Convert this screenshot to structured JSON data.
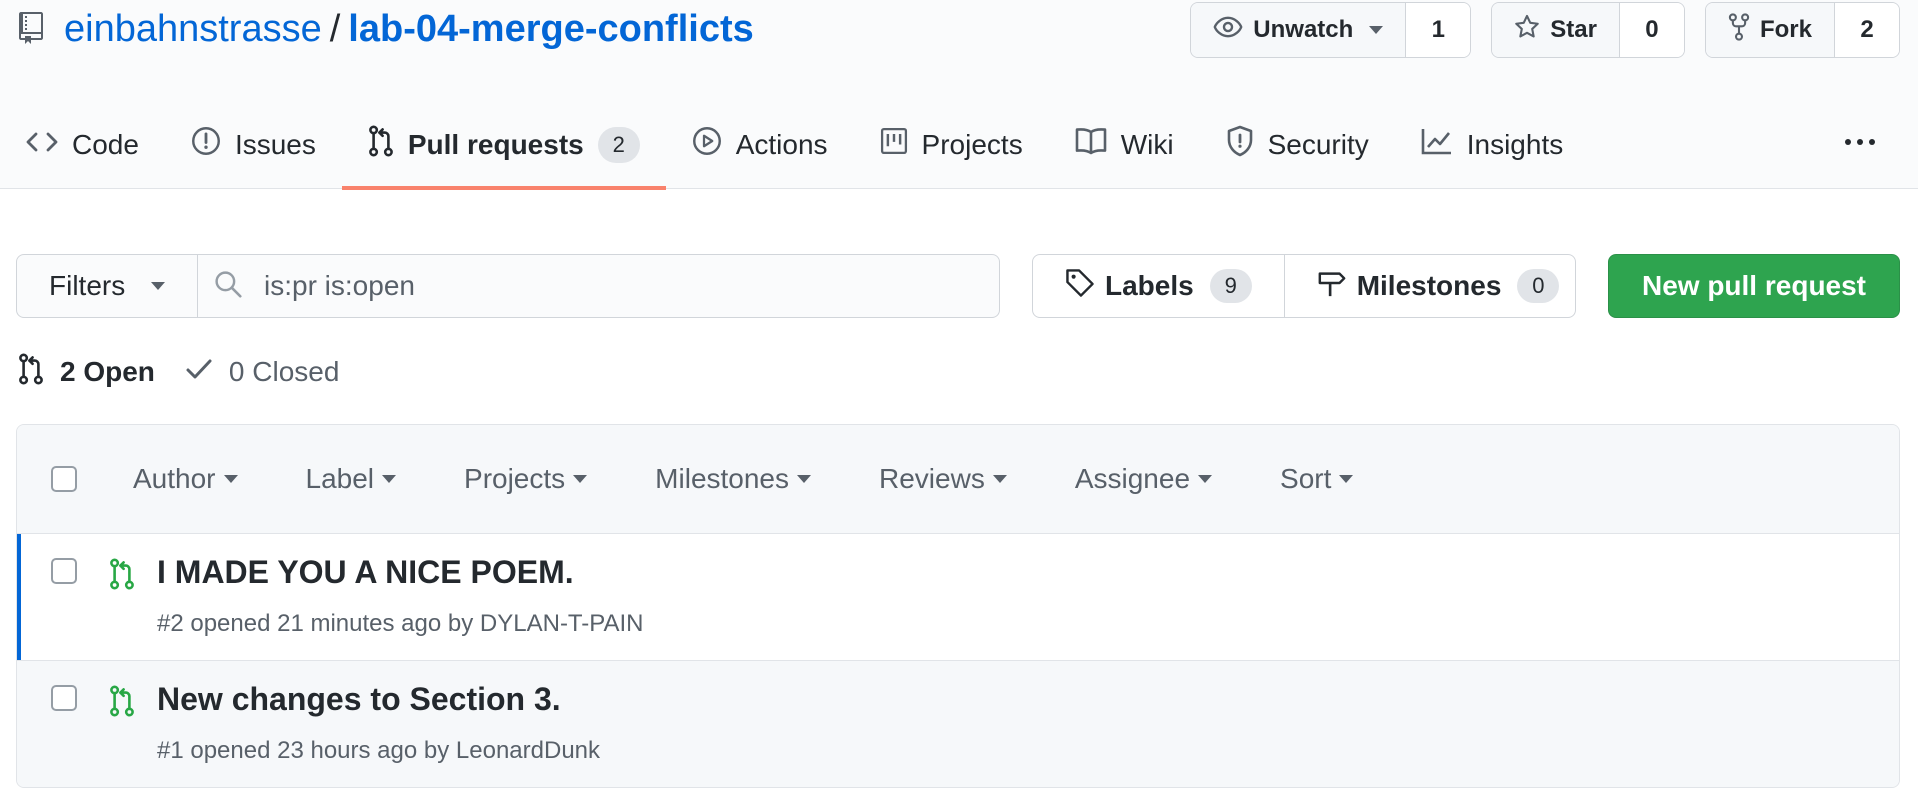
{
  "repo": {
    "owner": "einbahnstrasse",
    "separator": "/",
    "name": "lab-04-merge-conflicts"
  },
  "actions": {
    "watch": {
      "label": "Unwatch",
      "count": "1"
    },
    "star": {
      "label": "Star",
      "count": "0"
    },
    "fork": {
      "label": "Fork",
      "count": "2"
    }
  },
  "tabs": [
    {
      "label": "Code",
      "icon": "code-icon"
    },
    {
      "label": "Issues",
      "icon": "issue-icon"
    },
    {
      "label": "Pull requests",
      "icon": "git-pull-request-icon",
      "count": "2",
      "selected": true
    },
    {
      "label": "Actions",
      "icon": "play-icon"
    },
    {
      "label": "Projects",
      "icon": "project-icon"
    },
    {
      "label": "Wiki",
      "icon": "book-icon"
    },
    {
      "label": "Security",
      "icon": "shield-icon"
    },
    {
      "label": "Insights",
      "icon": "graph-icon"
    }
  ],
  "filters": {
    "button_label": "Filters",
    "search_value": "is:pr is:open",
    "labels_label": "Labels",
    "labels_count": "9",
    "milestones_label": "Milestones",
    "milestones_count": "0",
    "new_pr_label": "New pull request"
  },
  "states": {
    "open": "2 Open",
    "closed": "0 Closed"
  },
  "list_header": {
    "filters": [
      "Author",
      "Label",
      "Projects",
      "Milestones",
      "Reviews",
      "Assignee",
      "Sort"
    ]
  },
  "pull_requests": [
    {
      "title": "I MADE YOU A NICE POEM.",
      "meta": "#2 opened 21 minutes ago by DYLAN-T-PAIN"
    },
    {
      "title": "New changes to Section 3.",
      "meta": "#1 opened 23 hours ago by LeonardDunk"
    }
  ],
  "colors": {
    "link": "#0366d6",
    "accent_tab": "#f9826c",
    "green": "#2ea44f",
    "pr_open": "#28a745"
  }
}
